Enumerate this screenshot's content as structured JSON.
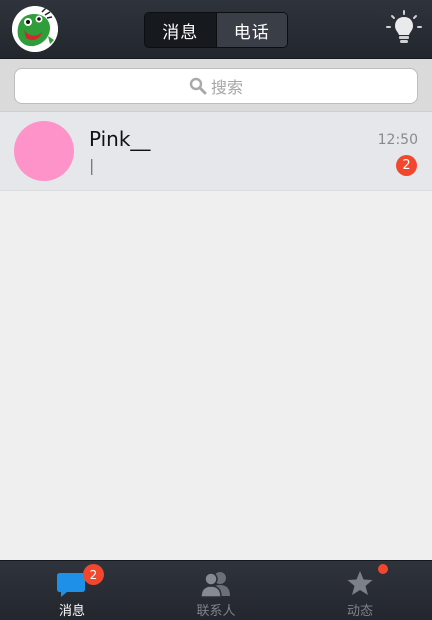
{
  "header": {
    "tabs": [
      {
        "label": "消息",
        "active": true
      },
      {
        "label": "电话",
        "active": false
      }
    ],
    "profile_icon": "frog-avatar-icon",
    "right_icon": "lightbulb-icon"
  },
  "search": {
    "placeholder": "搜索",
    "icon": "search-icon"
  },
  "conversations": [
    {
      "name": "Pink__",
      "preview": "|",
      "time": "12:50",
      "unread": "2",
      "avatar_color": "#fe93c9"
    }
  ],
  "bottom_tabs": [
    {
      "label": "消息",
      "icon": "message-bubble-icon",
      "badge": "2",
      "active": true
    },
    {
      "label": "联系人",
      "icon": "contacts-icon",
      "active": false
    },
    {
      "label": "动态",
      "icon": "star-icon",
      "has_dot": true,
      "active": false
    }
  ],
  "colors": {
    "accent_badge": "#f2472d",
    "header_bg": "#2b2f36",
    "tab_active_icon": "#1e90e8"
  }
}
